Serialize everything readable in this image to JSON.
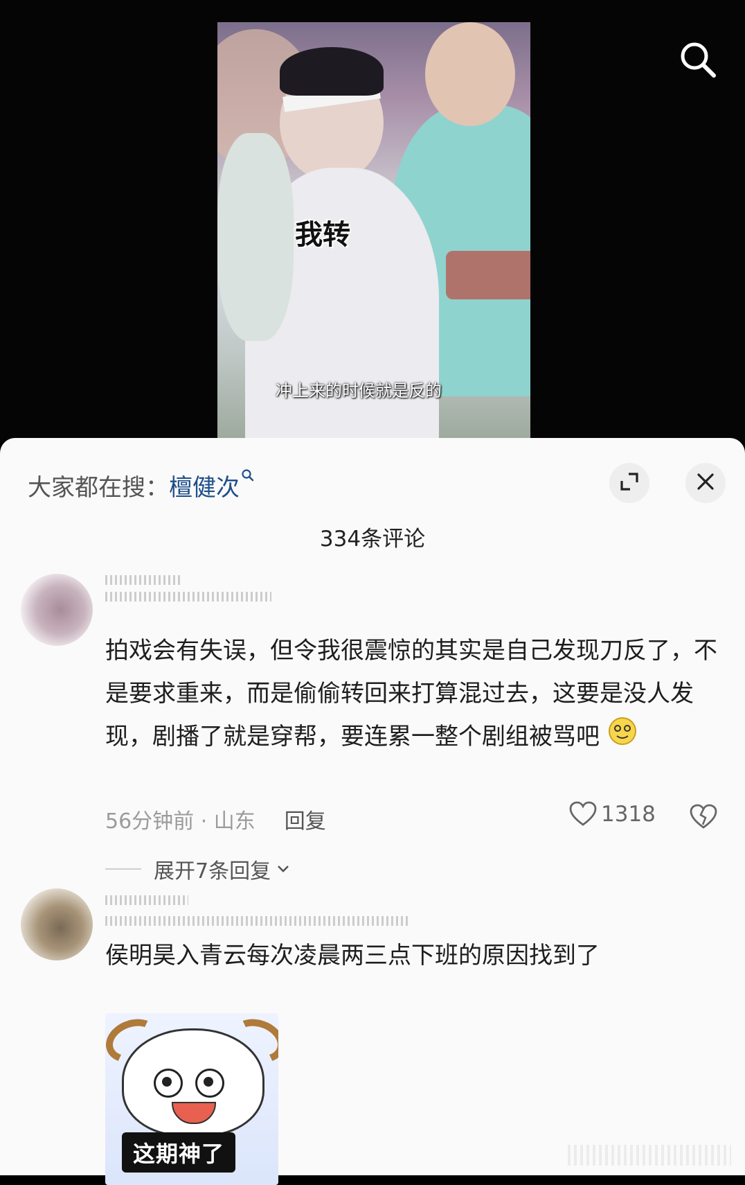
{
  "video": {
    "overlay_text": "我转",
    "subtitle": "冲上来的时候就是反的"
  },
  "panel": {
    "search_prefix": "大家都在搜：",
    "search_keyword": "檀健次",
    "comment_count": "334条评论"
  },
  "comments": [
    {
      "text": "拍戏会有失误，但令我很震惊的其实是自己发现刀反了，不是要求重来，而是偷偷转回来打算混过去，这要是没人发现，剧播了就是穿帮，要连累一整个剧组被骂吧",
      "emoji": "dizzy-face-emoji",
      "time_location": "56分钟前 · 山东",
      "reply_label": "回复",
      "likes": "1318",
      "expand_label": "展开7条回复"
    },
    {
      "text": "侯明昊入青云每次凌晨两三点下班的原因找到了",
      "sticker_caption": "这期神了"
    }
  ],
  "icons": {
    "search": "search-icon",
    "expand": "expand-icon",
    "close": "close-icon",
    "like": "heart-icon",
    "dislike": "broken-heart-icon",
    "chevron": "chevron-down-icon"
  }
}
